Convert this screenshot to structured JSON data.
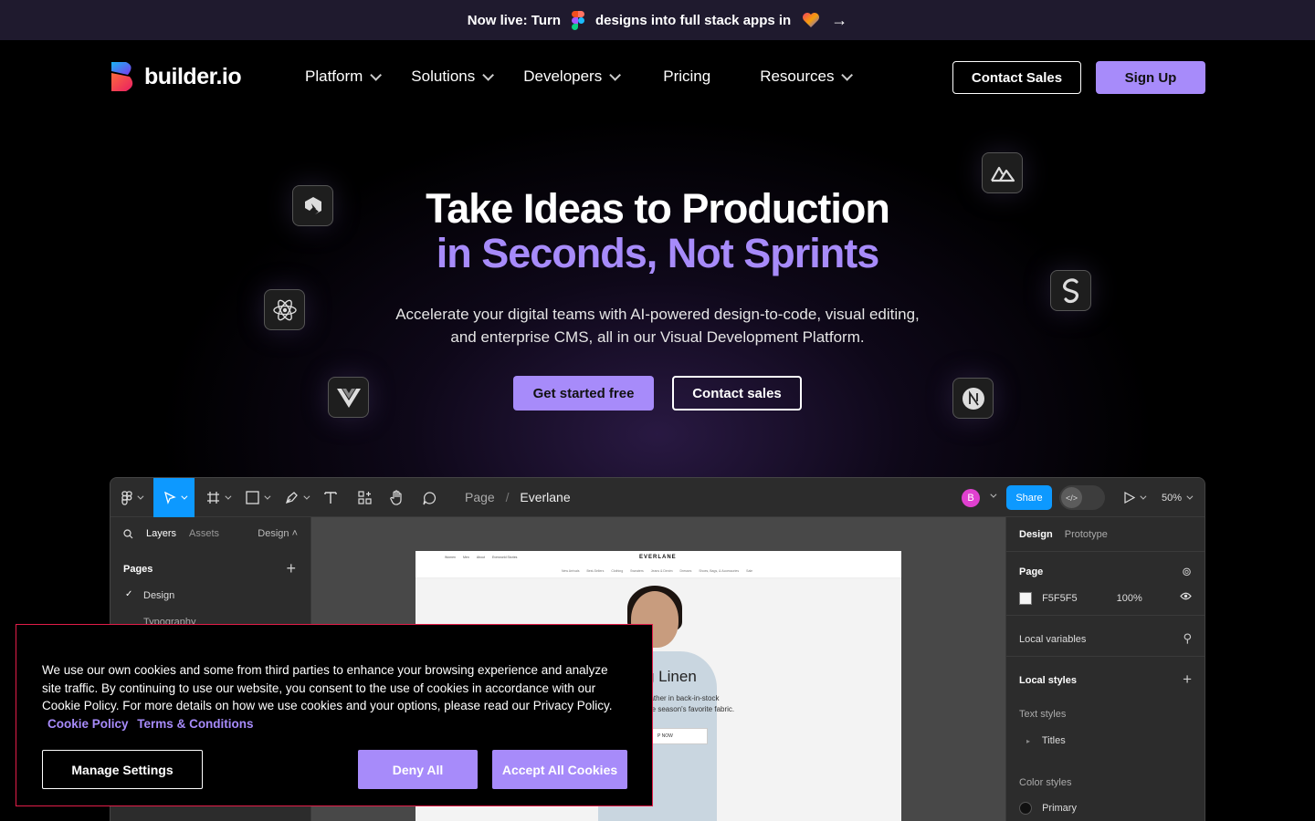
{
  "announcement": {
    "part1": "Now live: Turn",
    "part2": "designs into full stack apps in",
    "figma_icon": "figma-icon",
    "heart_icon": "heart-icon",
    "arrow": "→"
  },
  "nav": {
    "logo_text": "builder.io",
    "links": [
      {
        "label": "Platform",
        "dropdown": true
      },
      {
        "label": "Solutions",
        "dropdown": true
      },
      {
        "label": "Developers",
        "dropdown": true
      },
      {
        "label": "Pricing",
        "dropdown": false
      },
      {
        "label": "Resources",
        "dropdown": true
      }
    ],
    "contact_sales": "Contact Sales",
    "sign_up": "Sign Up"
  },
  "hero": {
    "title_line1": "Take Ideas to Production",
    "title_line2": "in Seconds, Not Sprints",
    "subtitle": "Accelerate your digital teams with AI-powered design-to-code, visual editing, and enterprise CMS, all in our Visual Development Platform.",
    "cta_primary": "Get started free",
    "cta_secondary": "Contact sales",
    "framework_icons": [
      "qwik-icon",
      "react-icon",
      "vue-icon",
      "nuxt-icon",
      "svelte-icon",
      "nextjs-icon"
    ]
  },
  "editor": {
    "breadcrumb_root": "Page",
    "breadcrumb_sep": "/",
    "breadcrumb_current": "Everlane",
    "avatar_letter": "B",
    "share_label": "Share",
    "zoom": "50%",
    "left_panel": {
      "tab_layers": "Layers",
      "tab_assets": "Assets",
      "design_dropdown": "Design",
      "pages_heading": "Pages",
      "pages": [
        "Design",
        "Typography"
      ]
    },
    "right_panel": {
      "tab_design": "Design",
      "tab_prototype": "Prototype",
      "page_heading": "Page",
      "page_color": "F5F5F5",
      "page_opacity": "100%",
      "local_variables": "Local variables",
      "local_styles": "Local styles",
      "text_styles": "Text styles",
      "text_style_item": "Titles",
      "color_styles": "Color styles",
      "color_style_item": "Primary"
    },
    "site_preview": {
      "brand": "EVERLANE",
      "menu": [
        "Women",
        "Men",
        "About",
        "Everworld Stories"
      ],
      "categories": [
        "New Arrivals",
        "Best-Sellers",
        "Clothing",
        "Sweaters",
        "Jeans & Denim",
        "Dresses",
        "Shoes, Bags, & Accessories",
        "Sale"
      ],
      "headline": "g Linen",
      "body_line1": "eather in back-in-stock",
      "body_line2": "the season's favorite fabric.",
      "shop_label": "P NOW"
    }
  },
  "cookie": {
    "text": "We use our own cookies and some from third parties to enhance your browsing experience and analyze site traffic. By continuing to use our website, you consent to the use of cookies in accordance with our Cookie Policy. For more details on how we use cookies and your options, please read our Privacy Policy.",
    "link_policy": "Cookie Policy",
    "link_terms": "Terms & Conditions",
    "manage": "Manage Settings",
    "deny": "Deny All",
    "accept": "Accept All Cookies"
  },
  "colors": {
    "accent": "#a78bfa",
    "announcement_bg": "#1f1a2e",
    "figma_blue": "#0d99ff",
    "cookie_border": "#e11d48"
  }
}
